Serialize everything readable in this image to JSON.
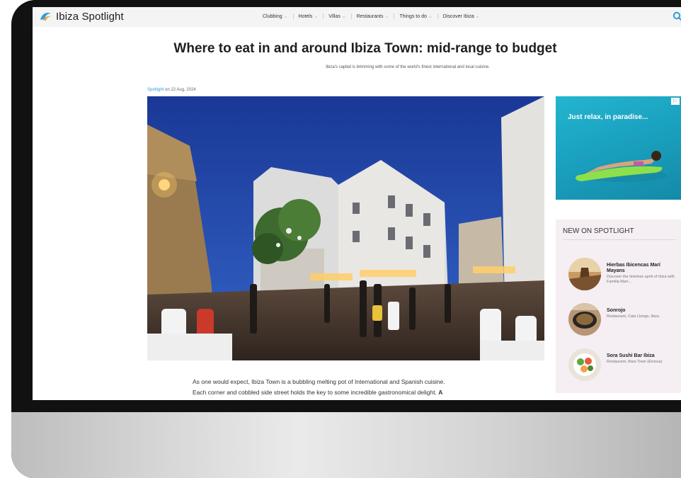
{
  "site": {
    "brand": "Ibiza Spotlight"
  },
  "nav": {
    "items": [
      {
        "label": "Clubbing"
      },
      {
        "label": "Hotels"
      },
      {
        "label": "Villas"
      },
      {
        "label": "Restaurants"
      },
      {
        "label": "Things to do"
      },
      {
        "label": "Discover Ibiza"
      }
    ],
    "caret": "⌄"
  },
  "article": {
    "title": "Where to eat in and around Ibiza Town: mid-range to budget",
    "subtitle": "Ibiza's capital is brimming with some of the world's finest international and local cuisine.",
    "author": "Spotlight",
    "date_prefix": " on ",
    "date": "22 Aug, 2024",
    "body_line1": "As one would expect, Ibiza Town is a bubbling melting pot of International and Spanish cuisine.",
    "body_line2": "Each corner and cobbled side street holds the key to some incredible gastronomical delight. ",
    "body_bold": "A"
  },
  "ad": {
    "text": "Just relax, in paradise...",
    "corner": "▷"
  },
  "sidebar": {
    "heading": "NEW ON SPOTLIGHT",
    "items": [
      {
        "title": "Hierbas Ibicencas Marí Mayans",
        "desc": "Discover the timeless spirit of Ibiza with Familia Marí..."
      },
      {
        "title": "Sonrojo",
        "desc": "Restaurant, Cala Llonga, Ibiza"
      },
      {
        "title": "Sora Sushi Bar Ibiza",
        "desc": "Restaurant, Ibiza Town (Eivissa)"
      }
    ]
  },
  "colors": {
    "accent": "#2a9fd6",
    "caret": "#f2a24b",
    "sidebar_bg": "#f5eef3"
  }
}
